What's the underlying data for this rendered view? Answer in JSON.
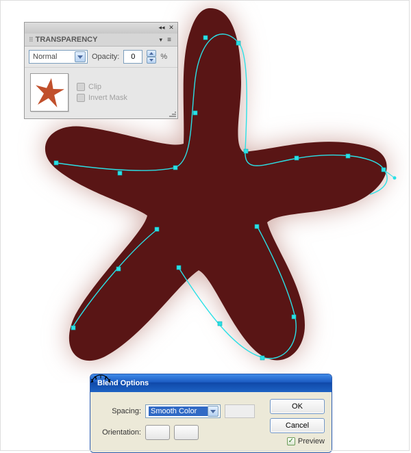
{
  "transparency": {
    "title": "TRANSPARENCY",
    "blendModeSelected": "Normal",
    "opacityLabel": "Opacity:",
    "opacityValue": "0",
    "pct": "%",
    "clipLabel": "Clip",
    "invertMaskLabel": "Invert Mask",
    "icons": {
      "min": "◂◂",
      "close": "✕",
      "chev": "▾",
      "menu": "≡"
    }
  },
  "blend": {
    "title": "Blend Options",
    "spacingLabel": "Spacing:",
    "spacingSelected": "Smooth Color",
    "orientationLabel": "Orientation:",
    "ok": "OK",
    "cancel": "Cancel",
    "previewLabel": "Preview",
    "previewChecked": "✓"
  }
}
